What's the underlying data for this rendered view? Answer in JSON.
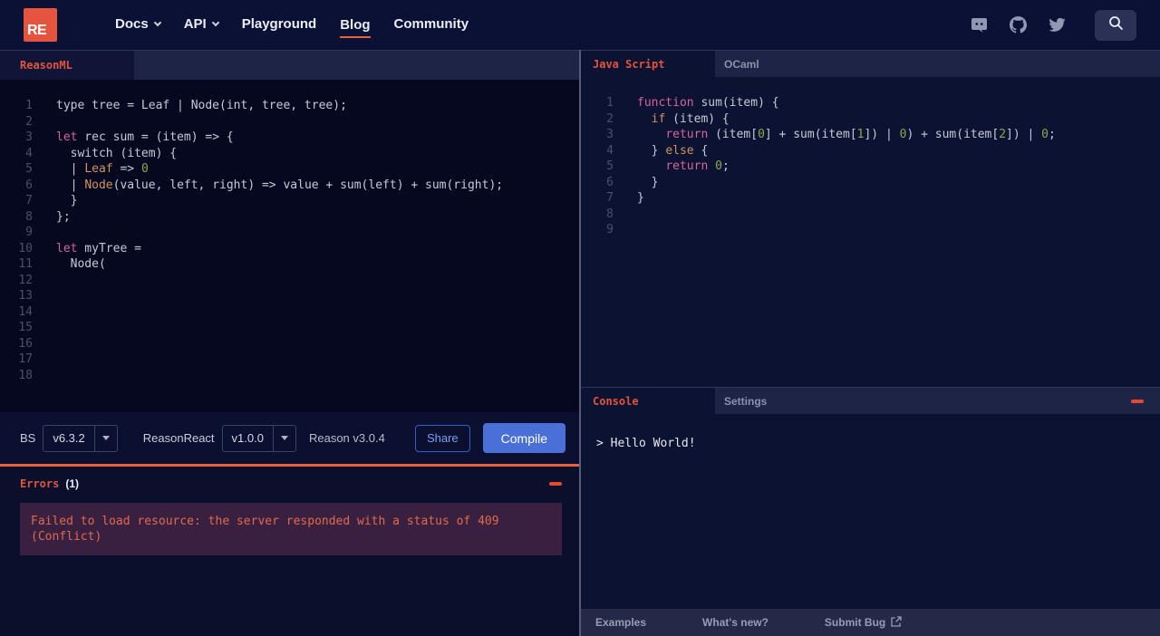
{
  "navbar": {
    "logo_text": "RE",
    "items": [
      {
        "label": "Docs",
        "dropdown": true
      },
      {
        "label": "API",
        "dropdown": true
      },
      {
        "label": "Playground",
        "dropdown": false
      },
      {
        "label": "Blog",
        "dropdown": false,
        "active": true
      },
      {
        "label": "Community",
        "dropdown": false
      }
    ],
    "icons": [
      "discord-icon",
      "github-icon",
      "twitter-icon",
      "search-icon"
    ]
  },
  "left": {
    "tab": "ReasonML",
    "code": [
      [
        [
          "d",
          "type tree = Leaf | Node(int, tree, tree);"
        ]
      ],
      [],
      [
        [
          "k",
          "let"
        ],
        [
          "d",
          " rec sum = (item) => {"
        ]
      ],
      [
        [
          "d",
          "  switch (item) {"
        ]
      ],
      [
        [
          "d",
          "  | "
        ],
        [
          "o",
          "Leaf"
        ],
        [
          "d",
          " => "
        ],
        [
          "g",
          "0"
        ]
      ],
      [
        [
          "d",
          "  | "
        ],
        [
          "o",
          "Node"
        ],
        [
          "d",
          "(value, left, right) => value + sum(left) + sum(right);"
        ]
      ],
      [
        [
          "d",
          "  }"
        ]
      ],
      [
        [
          "d",
          "};"
        ]
      ],
      [],
      [
        [
          "k",
          "let"
        ],
        [
          "d",
          " myTree ="
        ]
      ],
      [
        [
          "d",
          "  Node("
        ]
      ],
      [],
      [],
      [],
      [],
      [],
      [],
      []
    ],
    "toolbar": {
      "bs_label": "BS",
      "bs_version": "v6.3.2",
      "reasonreact_label": "ReasonReact",
      "reasonreact_version": "v1.0.0",
      "reason_version": "Reason v3.0.4",
      "share_label": "Share",
      "compile_label": "Compile"
    },
    "errors": {
      "title": "Errors",
      "count": "(1)",
      "message": "Failed to load resource: the server responded with a status of 409 (Conflict)"
    }
  },
  "right": {
    "tabs": [
      "Java Script",
      "OCaml"
    ],
    "code": [
      [
        [
          "k",
          "function"
        ],
        [
          "d",
          " sum(item) {"
        ]
      ],
      [
        [
          "d",
          "  "
        ],
        [
          "o",
          "if"
        ],
        [
          "d",
          " (item) {"
        ]
      ],
      [
        [
          "d",
          "    "
        ],
        [
          "k",
          "return"
        ],
        [
          "d",
          " (item["
        ],
        [
          "g",
          "0"
        ],
        [
          "d",
          "] + sum(item["
        ],
        [
          "g",
          "1"
        ],
        [
          "d",
          "]) | "
        ],
        [
          "g",
          "0"
        ],
        [
          "d",
          ") + sum(item["
        ],
        [
          "g",
          "2"
        ],
        [
          "d",
          "]) | "
        ],
        [
          "g",
          "0"
        ],
        [
          "d",
          ";"
        ]
      ],
      [
        [
          "d",
          "  } "
        ],
        [
          "o",
          "else"
        ],
        [
          "d",
          " {"
        ]
      ],
      [
        [
          "d",
          "    "
        ],
        [
          "k",
          "return"
        ],
        [
          "d",
          " "
        ],
        [
          "g",
          "0"
        ],
        [
          "d",
          ";"
        ]
      ],
      [
        [
          "d",
          "  }"
        ]
      ],
      [
        [
          "d",
          "}"
        ]
      ],
      [],
      []
    ],
    "console": {
      "tabs": [
        "Console",
        "Settings"
      ],
      "output": "> Hello World!"
    },
    "footer": {
      "links": [
        "Examples",
        "What's new?",
        "Submit Bug"
      ]
    }
  },
  "colors": {
    "accent_red": "#e2543c",
    "logo_orange": "#e4543f",
    "divider_orange": "#e8603c",
    "compile_blue": "#4a70d8",
    "share_blue": "#7d9ff0",
    "error_box_bg": "#3a2040",
    "code_pink": "#d4639e",
    "code_orange": "#cf9460",
    "code_green": "#8ba84e"
  }
}
